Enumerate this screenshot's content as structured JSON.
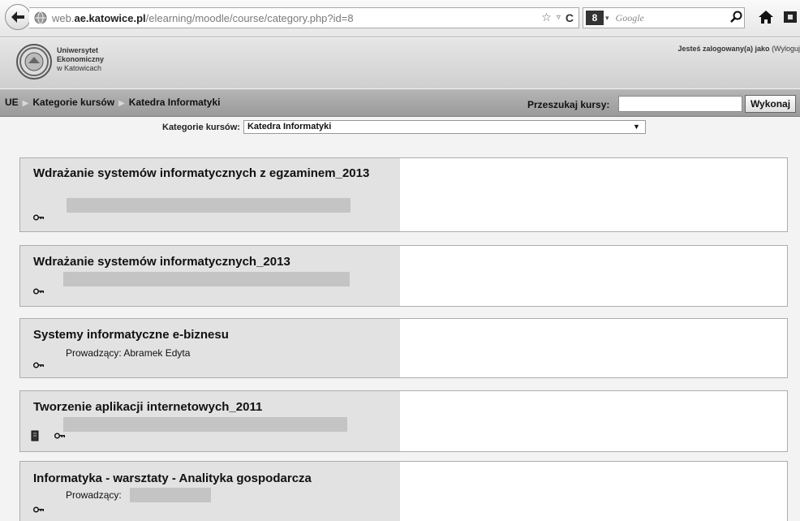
{
  "browser": {
    "url_prefix": "web.",
    "url_domain": "ae.katowice.pl",
    "url_path": "/elearning/moodle/course/category.php?id=8",
    "search_engine_badge": "8",
    "search_placeholder": "Google"
  },
  "site": {
    "logo_line1": "Uniwersytet",
    "logo_line2": "Ekonomiczny",
    "logo_line3": "w Katowicach",
    "login_text": "Jesteś zalogowany(a) jako",
    "logout_text": "(Wyloguj"
  },
  "navbar": {
    "breadcrumb": [
      "UE",
      "Kategorie kursów",
      "Katedra Informatyki"
    ],
    "search_label": "Przeszukaj kursy:",
    "search_value": "",
    "run_button": "Wykonaj"
  },
  "category": {
    "label": "Kategorie kursów:",
    "selected": "Katedra Informatyki"
  },
  "courses": [
    {
      "title": "Wdrażanie systemów informatycznych z egzaminem_2013"
    },
    {
      "title": "Wdrażanie systemów informatycznych_2013"
    },
    {
      "title": "Systemy informatyczne e-biznesu",
      "teacher_label": "Prowadzący:",
      "teacher_name": "Abramek Edyta"
    },
    {
      "title": "Tworzenie aplikacji internetowych_2011"
    },
    {
      "title": "Informatyka - warsztaty - Analityka gospodarcza",
      "teacher_label": "Prowadzący:"
    }
  ],
  "icons": {
    "back": "back-arrow-icon",
    "globe": "globe-icon",
    "star": "star-icon",
    "reload": "reload-icon",
    "search": "magnifier-icon",
    "home": "home-icon",
    "key": "key-icon",
    "doc": "document-icon"
  }
}
